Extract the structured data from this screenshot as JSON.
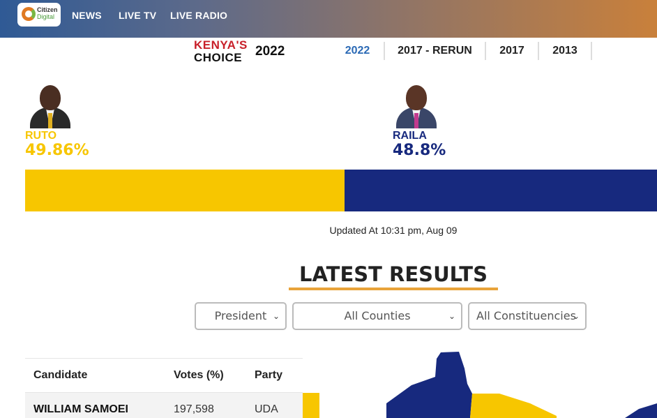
{
  "nav": {
    "logo_line1": "Citizen",
    "logo_line2": "Digital",
    "items": [
      "NEWS",
      "LIVE TV",
      "LIVE RADIO"
    ]
  },
  "brand": {
    "line1": "KENYA'S",
    "line2": "CHOICE",
    "year": "2022"
  },
  "year_tabs": [
    "2022",
    "2017 - RERUN",
    "2017",
    "2013"
  ],
  "active_year": "2022",
  "candidates": [
    {
      "name": "RUTO",
      "percent": "49.86%",
      "share": 49.86,
      "color": "#f7c600"
    },
    {
      "name": "RAILA",
      "percent": "48.8%",
      "share": 48.8,
      "color": "#17297e"
    }
  ],
  "updated": "Updated At 10:31 pm, Aug 09",
  "latest_results": {
    "title": "LATEST RESULTS",
    "filters": [
      {
        "selected": "President"
      },
      {
        "selected": "All Counties"
      },
      {
        "selected": "All Constituencies"
      }
    ]
  },
  "results_table": {
    "headers": [
      "Candidate",
      "Votes (%)",
      "Party"
    ],
    "rows": [
      {
        "candidate": "WILLIAM SAMOEI",
        "votes": "197,598",
        "party": "UDA",
        "color": "#f7c600"
      }
    ]
  },
  "colors": {
    "accent_blue": "#2a69b5",
    "underline_orange": "#e8a33a",
    "uda_yellow": "#f7c600",
    "azimio_blue": "#17297e"
  }
}
